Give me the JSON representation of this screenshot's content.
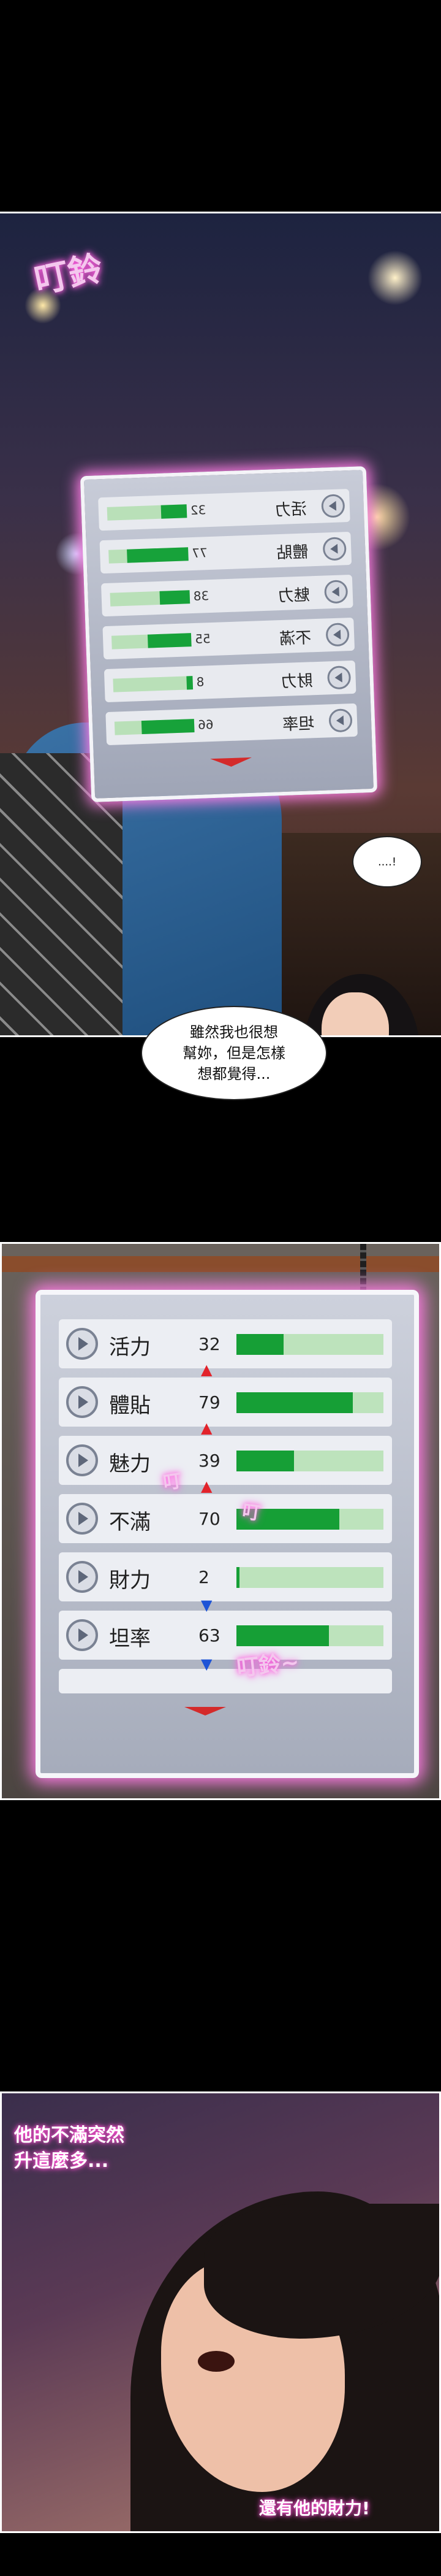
{
  "panel1": {
    "sfx": "叮鈴",
    "status_rows": [
      {
        "label": "活力",
        "value": "32",
        "level": 32
      },
      {
        "label": "體貼",
        "value": "77",
        "level": 77
      },
      {
        "label": "魅力",
        "value": "38",
        "level": 38
      },
      {
        "label": "不滿",
        "value": "55",
        "level": 55
      },
      {
        "label": "財力",
        "value": "8",
        "level": 8
      },
      {
        "label": "坦率",
        "value": "66",
        "level": 66
      }
    ],
    "bubble_small": "....!",
    "bubble_main": "雖然我也很想\n幫妳，但是怎樣\n想都覺得..."
  },
  "panel2": {
    "status_rows": [
      {
        "label": "活力",
        "value": "32",
        "level": 32,
        "change": ""
      },
      {
        "label": "體貼",
        "value": "79",
        "level": 79,
        "change": "up"
      },
      {
        "label": "魅力",
        "value": "39",
        "level": 39,
        "change": "up"
      },
      {
        "label": "不滿",
        "value": "70",
        "level": 70,
        "change": "up"
      },
      {
        "label": "財力",
        "value": "2",
        "level": 2,
        "change": "down"
      },
      {
        "label": "坦率",
        "value": "63",
        "level": 63,
        "change": "down"
      }
    ],
    "sfx1": "叮",
    "sfx2": "叮",
    "sfx3": "叮鈴~",
    "colors": {
      "bar_fill": "#169f36",
      "bar_track": "#bde3bc",
      "up": "#e2232b",
      "down": "#1e54d6",
      "glow": "#ff7ee6"
    }
  },
  "panel3": {
    "caption_top": "他的不滿突然\n升這麼多...",
    "caption_bottom": "還有他的財力!"
  }
}
